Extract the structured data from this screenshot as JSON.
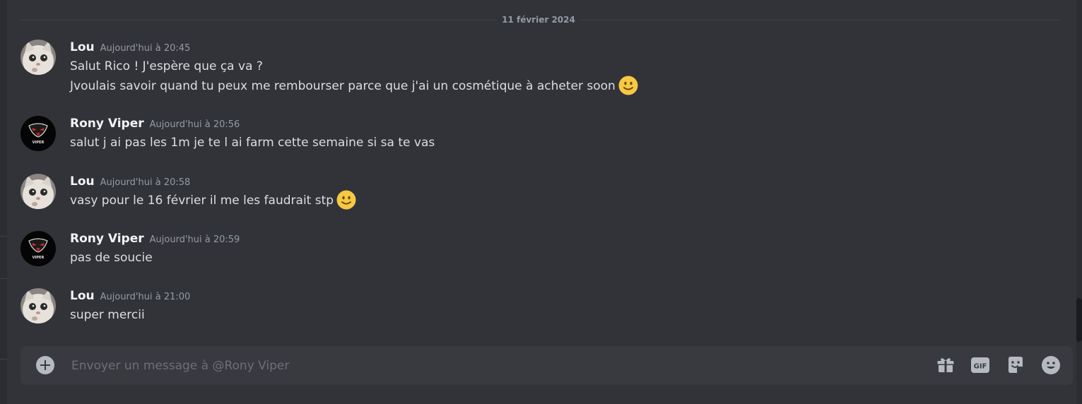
{
  "date_divider": "11 février 2024",
  "messages": [
    {
      "author": "Lou",
      "timestamp": "Aujourd'hui à 20:45",
      "avatar": "cat-avatar",
      "lines": [
        "Salut Rico ! J'espère que ça va ?",
        "Jvoulais savoir quand tu peux me rembourser parce que j'ai un cosmétique à acheter soon"
      ],
      "emoji": "slightly-smiling-face"
    },
    {
      "author": "Rony Viper",
      "timestamp": "Aujourd'hui à 20:56",
      "avatar": "viper-avatar",
      "avatar_text": "VIPER",
      "lines": [
        "salut j ai pas les 1m je te l ai farm cette semaine si sa te vas"
      ]
    },
    {
      "author": "Lou",
      "timestamp": "Aujourd'hui à 20:58",
      "avatar": "cat-avatar",
      "lines": [
        "vasy pour le 16 février il me les faudrait stp"
      ],
      "emoji": "slightly-smiling-face"
    },
    {
      "author": "Rony Viper",
      "timestamp": "Aujourd'hui à 20:59",
      "avatar": "viper-avatar",
      "avatar_text": "VIPER",
      "lines": [
        "pas de soucie"
      ]
    },
    {
      "author": "Lou",
      "timestamp": "Aujourd'hui à 21:00",
      "avatar": "cat-avatar",
      "lines": [
        "super mercii"
      ]
    }
  ],
  "composer": {
    "placeholder": "Envoyer un message à @Rony Viper",
    "value": "",
    "attach_icon": "plus-circle-icon",
    "tools": [
      {
        "name": "gift-icon"
      },
      {
        "name": "gif-icon",
        "label": "GIF"
      },
      {
        "name": "sticker-icon"
      },
      {
        "name": "emoji-icon"
      }
    ]
  },
  "colors": {
    "background": "#313338",
    "composer": "#383a40",
    "author": "#f2f3f5",
    "text": "#dbdee1",
    "muted": "#949ba4",
    "icon": "#b5bac1",
    "emoji": "#f7c843"
  }
}
